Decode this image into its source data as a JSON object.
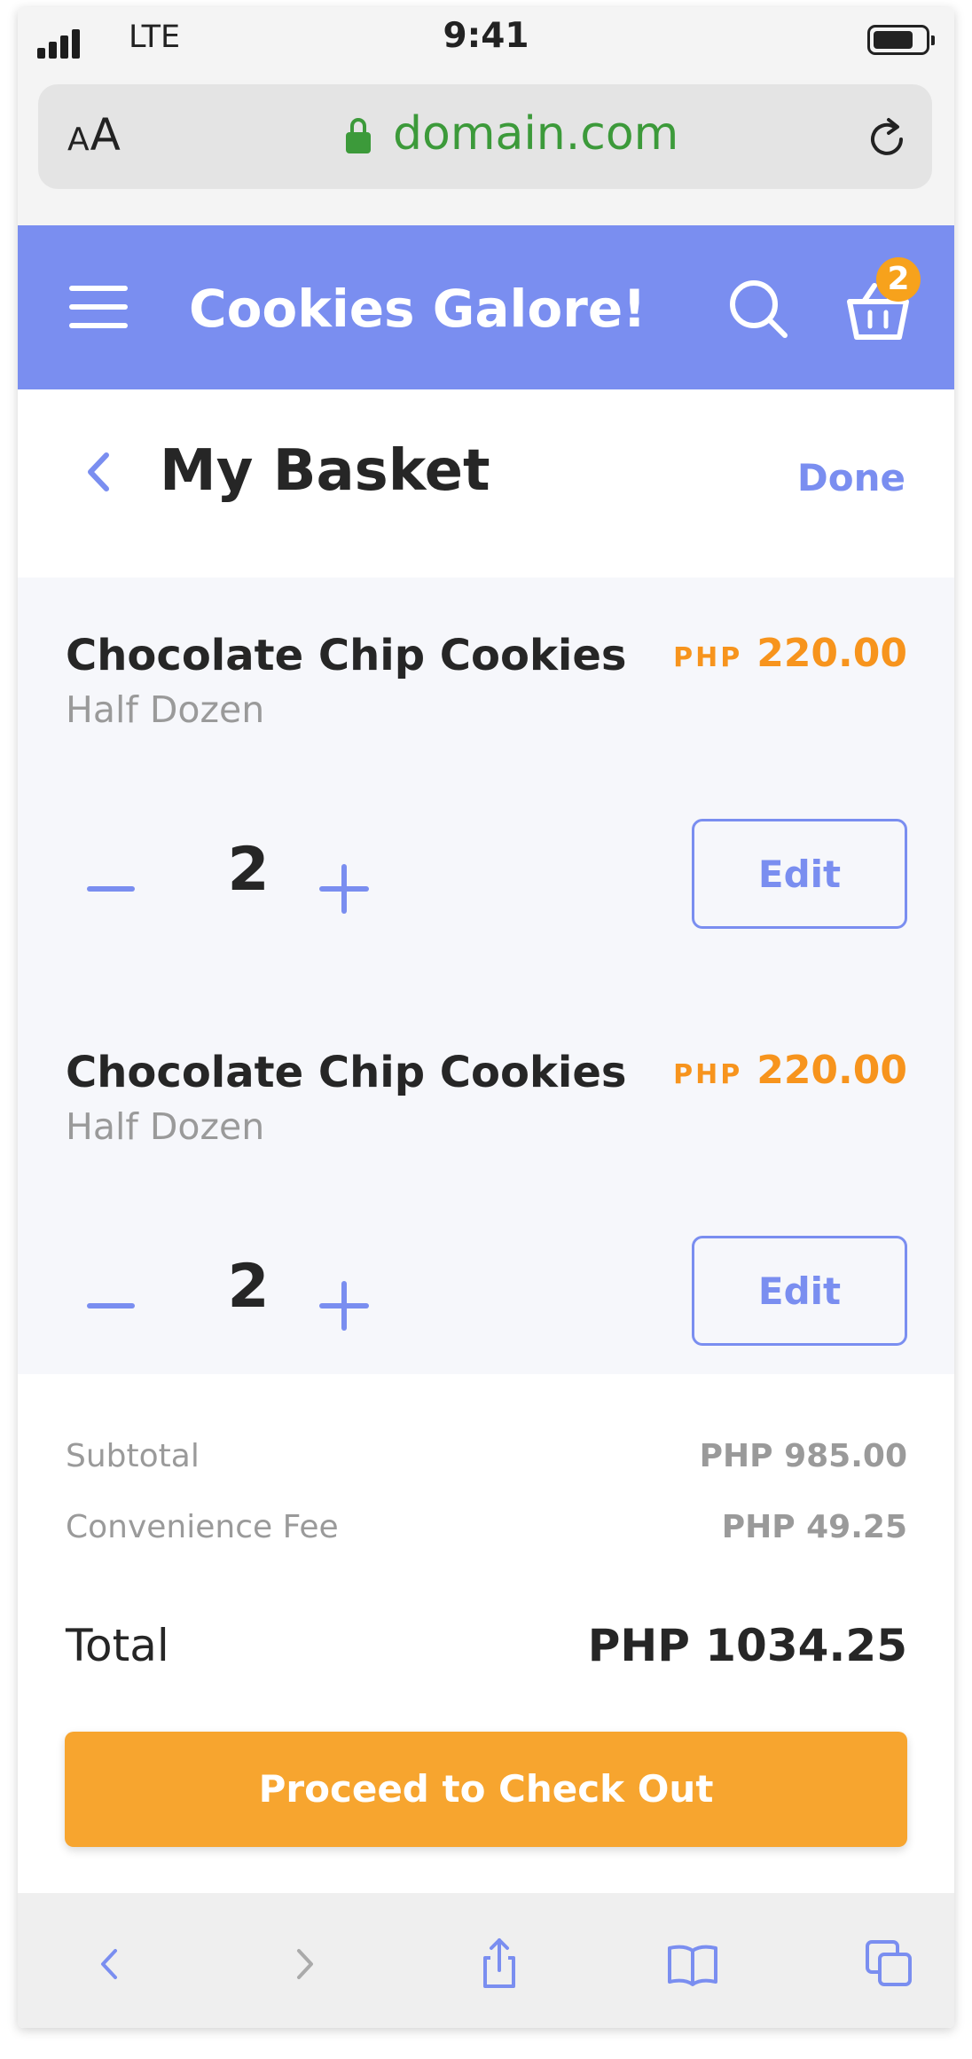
{
  "status_bar": {
    "carrier": "LTE",
    "time": "9:41"
  },
  "browser": {
    "text_size_label": "AA",
    "domain": "domain.com"
  },
  "app_header": {
    "title": "Cookies Galore!",
    "cart_count": "2"
  },
  "page": {
    "title": "My Basket",
    "done_label": "Done"
  },
  "items": [
    {
      "name": "Chocolate Chip Cookies",
      "variant": "Half Dozen",
      "currency": "PHP",
      "price": "220.00",
      "quantity": "2",
      "edit_label": "Edit"
    },
    {
      "name": "Chocolate Chip Cookies",
      "variant": "Half Dozen",
      "currency": "PHP",
      "price": "220.00",
      "quantity": "2",
      "edit_label": "Edit"
    }
  ],
  "summary": {
    "subtotal_label": "Subtotal",
    "subtotal_value": "PHP 985.00",
    "fee_label": "Convenience Fee",
    "fee_value": "PHP 49.25",
    "total_label": "Total",
    "total_value": "PHP 1034.25"
  },
  "checkout_label": "Proceed to Check Out",
  "colors": {
    "primary": "#7a8ef0",
    "accent": "#f7a52f",
    "price": "#f7941d",
    "secure": "#3c9a3a"
  },
  "toolbar_icons": [
    "back-icon",
    "forward-icon",
    "share-icon",
    "bookmarks-icon",
    "tabs-icon"
  ]
}
